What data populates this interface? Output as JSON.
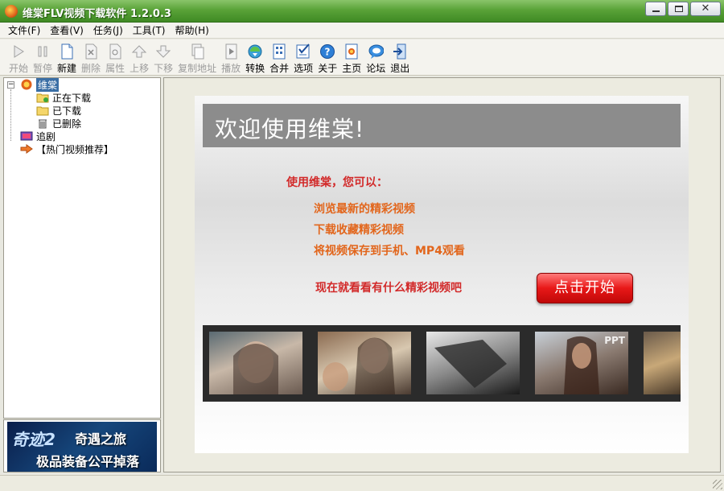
{
  "window": {
    "title": "维棠FLV视频下载软件 1.2.0.3"
  },
  "menu": [
    "文件(F)",
    "查看(V)",
    "任务(J)",
    "工具(T)",
    "帮助(H)"
  ],
  "toolbar": [
    {
      "label": "开始",
      "icon": "play-arrow-icon",
      "enabled": false
    },
    {
      "label": "暂停",
      "icon": "pause-icon",
      "enabled": false
    },
    {
      "label": "新建",
      "icon": "new-file-icon",
      "enabled": true
    },
    {
      "label": "删除",
      "icon": "delete-file-icon",
      "enabled": false
    },
    {
      "label": "属性",
      "icon": "properties-icon",
      "enabled": false
    },
    {
      "label": "上移",
      "icon": "move-up-icon",
      "enabled": false
    },
    {
      "label": "下移",
      "icon": "move-down-icon",
      "enabled": false
    },
    {
      "label": "复制地址",
      "icon": "copy-url-icon",
      "enabled": false
    },
    {
      "label": "播放",
      "icon": "play-media-icon",
      "enabled": false
    },
    {
      "label": "转换",
      "icon": "convert-icon",
      "enabled": true
    },
    {
      "label": "合并",
      "icon": "merge-icon",
      "enabled": true
    },
    {
      "label": "选项",
      "icon": "options-icon",
      "enabled": true
    },
    {
      "label": "关于",
      "icon": "help-icon",
      "enabled": true
    },
    {
      "label": "主页",
      "icon": "homepage-icon",
      "enabled": true
    },
    {
      "label": "论坛",
      "icon": "forum-icon",
      "enabled": true
    },
    {
      "label": "退出",
      "icon": "exit-icon",
      "enabled": true
    }
  ],
  "tree": {
    "root": "维棠",
    "children": [
      "正在下载",
      "已下载",
      "已删除"
    ],
    "extra": [
      "追剧",
      "【热门视频推荐】"
    ]
  },
  "ad": {
    "logo": "奇迹2",
    "line1": "奇遇之旅",
    "line2": "极品装备公平掉落"
  },
  "welcome": {
    "heading": "欢迎使用维棠!",
    "intro": "使用维棠，您可以：",
    "features": [
      "浏览最新的精彩视频",
      "下载收藏精彩视频",
      "将视频保存到手机、MP4观看"
    ],
    "cta": "现在就看看有什么精彩视频吧",
    "start_button": "点击开始",
    "thumb_watermark": "PPT"
  },
  "colors": {
    "accent_red": "#d22a2a",
    "accent_orange": "#e2661c",
    "titlebar_green": "#4f9a30"
  }
}
